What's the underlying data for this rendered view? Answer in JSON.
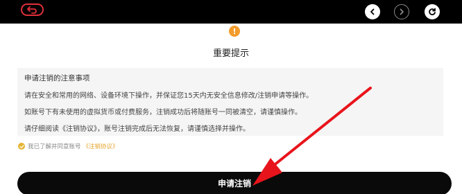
{
  "topbar": {
    "back_icon": "back-arrow-icon",
    "prev_icon": "chevron-left-icon",
    "next_icon": "chevron-right-icon",
    "refresh_icon": "refresh-icon"
  },
  "warning": {
    "symbol": "!"
  },
  "page": {
    "title": "重要提示"
  },
  "notice": {
    "title": "申请注销的注意事项",
    "lines": [
      "请在安全和常用的网络、设备环境下操作，并保证您15天内无安全信息修改/注销申请等操作。",
      "如账号下有未使用的虚拟货币或付费服务，注销成功后将随账号一同被清空，请谨慎操作。",
      "请仔细阅读《注销协议》，账号注销完成后无法恢复，请谨慎选择并操作。"
    ]
  },
  "agree": {
    "text": "我已了解并同意账号",
    "link": "《注销协议》"
  },
  "submit": {
    "label": "申请注销"
  },
  "colors": {
    "accent": "#e5a52b",
    "warning": "#f39c2b",
    "annotation_arrow": "#e8141b"
  }
}
